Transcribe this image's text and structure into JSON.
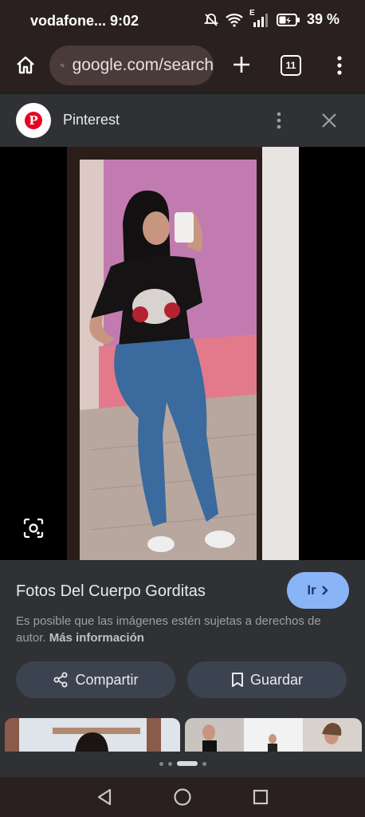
{
  "status_bar": {
    "carrier": "vodafone...",
    "time": "9:02",
    "network": "E",
    "battery": "39 %"
  },
  "toolbar": {
    "url": "google.com/search",
    "tab_count": "11",
    "icons": [
      "home-icon",
      "page-info-icon",
      "new-tab-icon",
      "tab-switcher-icon",
      "overflow-menu-icon"
    ]
  },
  "source": {
    "name": "Pinterest",
    "logo_letter": "P",
    "brand_color": "#e60023"
  },
  "result": {
    "title": "Fotos Del Cuerpo Gorditas",
    "visit_label": "Ir",
    "copyright_text": "Es posible que las imágenes estén sujetas a derechos de autor.",
    "more_info_label": "Más información",
    "share_label": "Compartir",
    "save_label": "Guardar",
    "accent": "#8ab4f8"
  },
  "carousel": {
    "page_count": 4,
    "active_page": 2
  }
}
